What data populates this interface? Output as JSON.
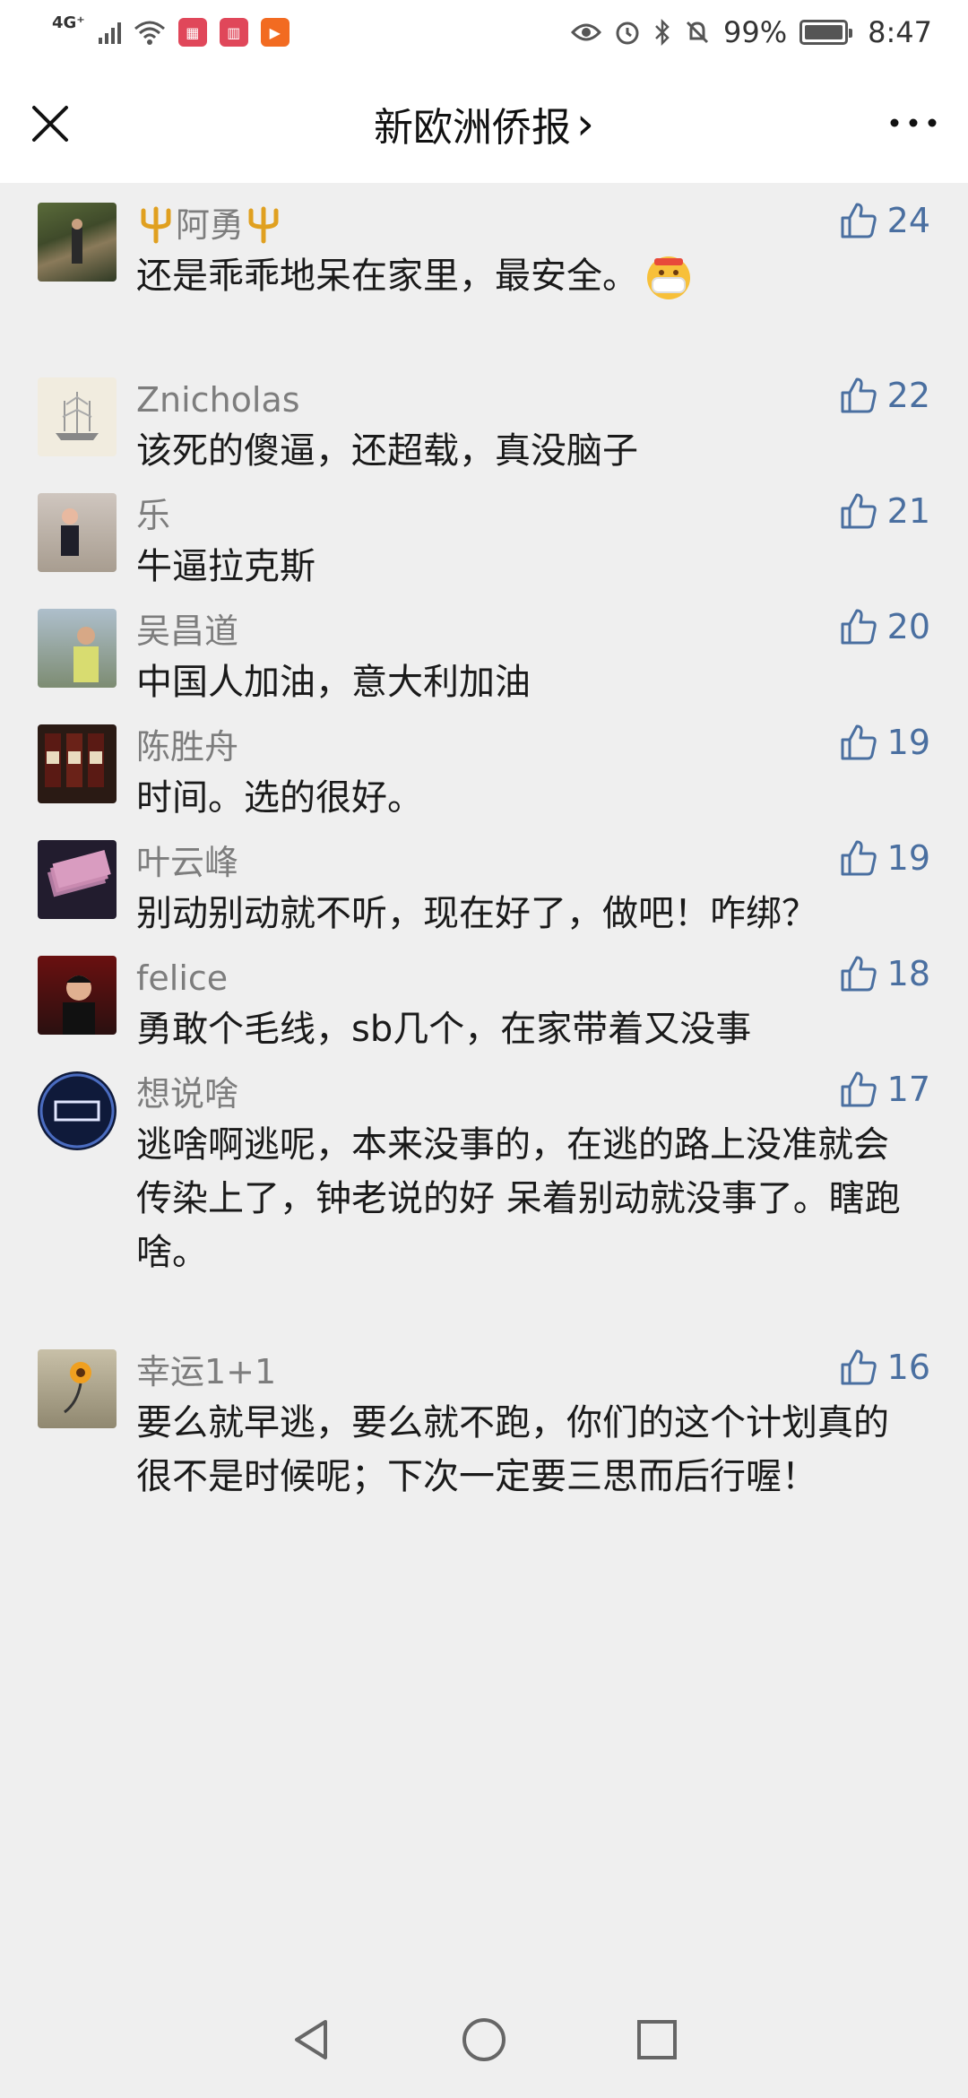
{
  "status": {
    "network": "4G⁺",
    "battery": "99%",
    "time": "8:47"
  },
  "header": {
    "title": "新欧洲侨报",
    "chevron": "›"
  },
  "comments": [
    {
      "name": "阿勇",
      "text": "还是乖乖地呆在家里，最安全。",
      "likes": "24"
    },
    {
      "name": "Znicholas",
      "text": "该死的傻逼，还超载，真没脑子",
      "likes": "22"
    },
    {
      "name": "乐",
      "text": "牛逼拉克斯",
      "likes": "21"
    },
    {
      "name": "吴昌道",
      "text": "中国人加油，意大利加油",
      "likes": "20"
    },
    {
      "name": "陈胜舟",
      "text": "时间。选的很好。",
      "likes": "19"
    },
    {
      "name": "叶云峰",
      "text": "别动别动就不听，现在好了，做吧！咋绑？",
      "likes": "19"
    },
    {
      "name": "felice",
      "text": "勇敢个毛线，sb几个，在家带着又没事",
      "likes": "18"
    },
    {
      "name": "想说啥",
      "text": "逃啥啊逃呢，本来没事的，在逃的路上没准就会传染上了，钟老说的好  呆着别动就没事了。瞎跑啥。",
      "likes": "17"
    },
    {
      "name": "幸运1+1",
      "text": "要么就早逃，要么就不跑，你们的这个计划真的很不是时候呢；下次一定要三思而后行喔！",
      "likes": "16"
    }
  ],
  "colors": {
    "like_blue": "#4a6fa0",
    "name_gray": "#7d7d7d",
    "background": "#efefef"
  },
  "icons": [
    "close-icon",
    "more-icon",
    "thumbs-up-icon",
    "back-nav-icon",
    "home-nav-icon",
    "recents-nav-icon"
  ]
}
